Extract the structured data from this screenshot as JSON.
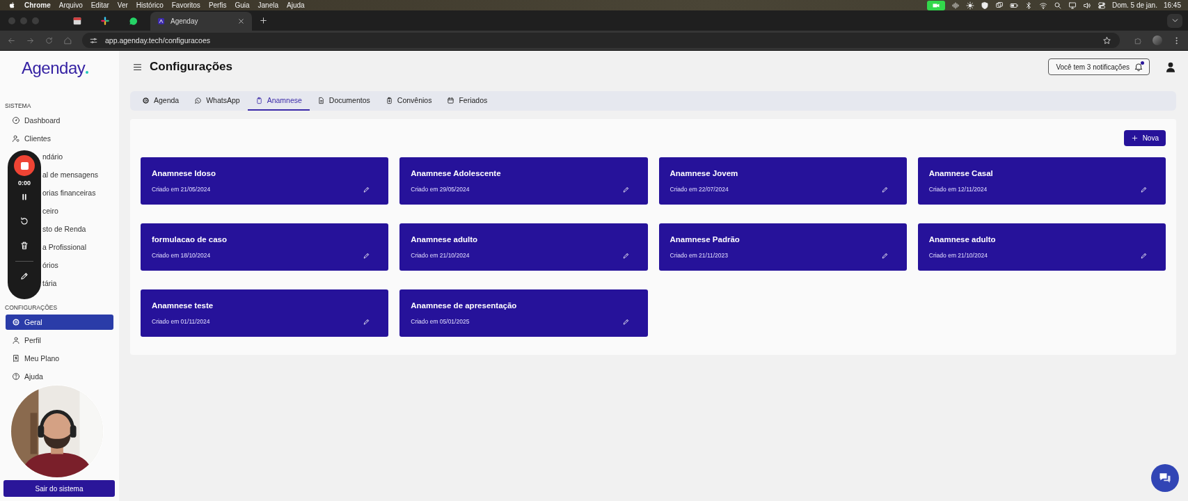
{
  "menu_bar": {
    "app": "Chrome",
    "menus": [
      "Arquivo",
      "Editar",
      "Ver",
      "Histórico",
      "Favoritos",
      "Perfis",
      "Guia",
      "Janela",
      "Ajuda"
    ],
    "date": "Dom. 5 de jan.",
    "time": "16:45"
  },
  "browser": {
    "tabs": [
      {
        "title": "Agenday",
        "selected": true
      }
    ],
    "address": "app.agenday.tech/configuracoes"
  },
  "sidebar": {
    "logo": "Agenday",
    "sections": [
      {
        "label": "SISTEMA",
        "items": [
          {
            "label": "Dashboard",
            "selected": false
          },
          {
            "label": "Clientes",
            "selected": false
          },
          {
            "label": "ndário",
            "selected": false
          },
          {
            "label": "al de mensagens",
            "selected": false
          },
          {
            "label": "orias financeiras",
            "selected": false
          },
          {
            "label": "ceiro",
            "selected": false
          },
          {
            "label": "sto de Renda",
            "selected": false
          },
          {
            "label": "a Profissional",
            "selected": false
          },
          {
            "label": "órios",
            "selected": false
          },
          {
            "label": "tária",
            "selected": false
          }
        ]
      },
      {
        "label": "CONFIGURAÇÕES",
        "items": [
          {
            "label": "Geral",
            "selected": true
          },
          {
            "label": "Perfil",
            "selected": false
          },
          {
            "label": "Meu Plano",
            "selected": false
          },
          {
            "label": "Ajuda",
            "selected": false
          }
        ]
      }
    ],
    "logout": "Sair do sistema"
  },
  "recorder": {
    "time": "0:00"
  },
  "header": {
    "title": "Configurações",
    "notifications": "Você tem 3 notificações",
    "unread": true
  },
  "tabs": [
    {
      "label": "Agenda",
      "selected": false
    },
    {
      "label": "WhatsApp",
      "selected": false
    },
    {
      "label": "Anamnese",
      "selected": true
    },
    {
      "label": "Documentos",
      "selected": false
    },
    {
      "label": "Convênios",
      "selected": false
    },
    {
      "label": "Feriados",
      "selected": false
    }
  ],
  "new_button": "Nova",
  "forms": [
    {
      "name": "Anamnese Idoso",
      "created": "Criado em 21/05/2024"
    },
    {
      "name": "Anamnese Adolescente",
      "created": "Criado em 29/05/2024"
    },
    {
      "name": "Anamnese Jovem",
      "created": "Criado em 22/07/2024"
    },
    {
      "name": "Anamnese Casal",
      "created": "Criado em 12/11/2024"
    },
    {
      "name": "formulacao de caso",
      "created": "Criado em 18/10/2024"
    },
    {
      "name": "Anamnese adulto",
      "created": "Criado em 21/10/2024"
    },
    {
      "name": "Anamnese Padrão",
      "created": "Criado em 21/11/2023"
    },
    {
      "name": "Anamnese adulto",
      "created": "Criado em 21/10/2024"
    },
    {
      "name": "Anamnese teste",
      "created": "Criado em 01/11/2024"
    },
    {
      "name": "Anamnese de apresentação",
      "created": "Criado em 05/01/2025"
    }
  ]
}
